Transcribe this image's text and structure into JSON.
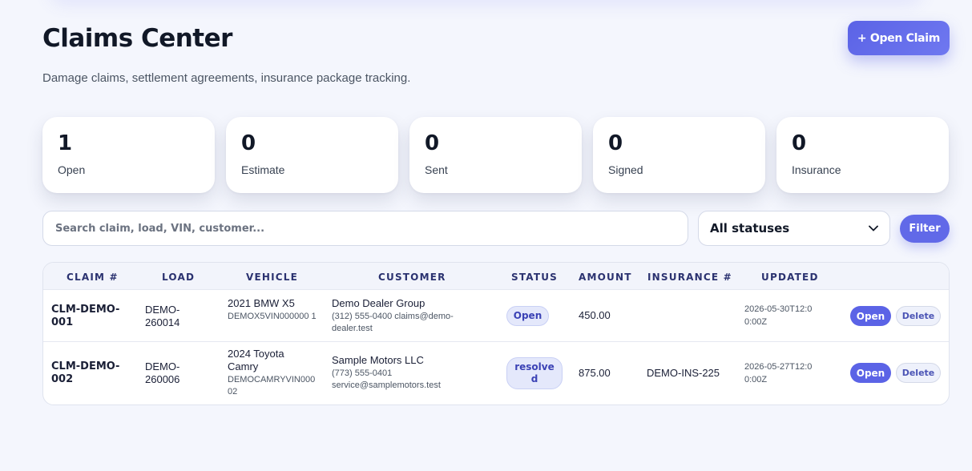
{
  "header": {
    "title": "Claims Center",
    "subtitle": "Damage claims, settlement agreements, insurance package tracking.",
    "open_claim_label": "+ Open Claim"
  },
  "stats": [
    {
      "value": "1",
      "label": "Open"
    },
    {
      "value": "0",
      "label": "Estimate"
    },
    {
      "value": "0",
      "label": "Sent"
    },
    {
      "value": "0",
      "label": "Signed"
    },
    {
      "value": "0",
      "label": "Insurance"
    }
  ],
  "filters": {
    "search_placeholder": "Search claim, load, VIN, customer...",
    "status_selected": "All statuses",
    "filter_label": "Filter"
  },
  "table": {
    "columns": [
      "Claim #",
      "Load",
      "Vehicle",
      "Customer",
      "Status",
      "Amount",
      "Insurance #",
      "Updated"
    ],
    "rows": [
      {
        "claim": "CLM-DEMO-001",
        "load": "DEMO-260014",
        "vehicle": "2021 BMW X5",
        "vin": "DEMOX5VIN000000 1",
        "customer": "Demo Dealer Group",
        "contact": "(312) 555-0400 claims@demo-dealer.test",
        "status": "Open",
        "amount": "450.00",
        "insurance": "",
        "updated": "2026-05-30T12:00:00Z",
        "open_label": "Open",
        "delete_label": "Delete"
      },
      {
        "claim": "CLM-DEMO-002",
        "load": "DEMO-260006",
        "vehicle": "2024 Toyota Camry",
        "vin": "DEMOCAMRYVIN000 02",
        "customer": "Sample Motors LLC",
        "contact": "(773) 555-0401 service@samplemotors.test",
        "status": "resolved",
        "amount": "875.00",
        "insurance": "DEMO-INS-225",
        "updated": "2026-05-27T12:00:00Z",
        "open_label": "Open",
        "delete_label": "Delete"
      }
    ]
  },
  "colors": {
    "accent": "#5b63e6",
    "background": "#f4f6fd",
    "pill_bg": "#e4e8fb"
  }
}
